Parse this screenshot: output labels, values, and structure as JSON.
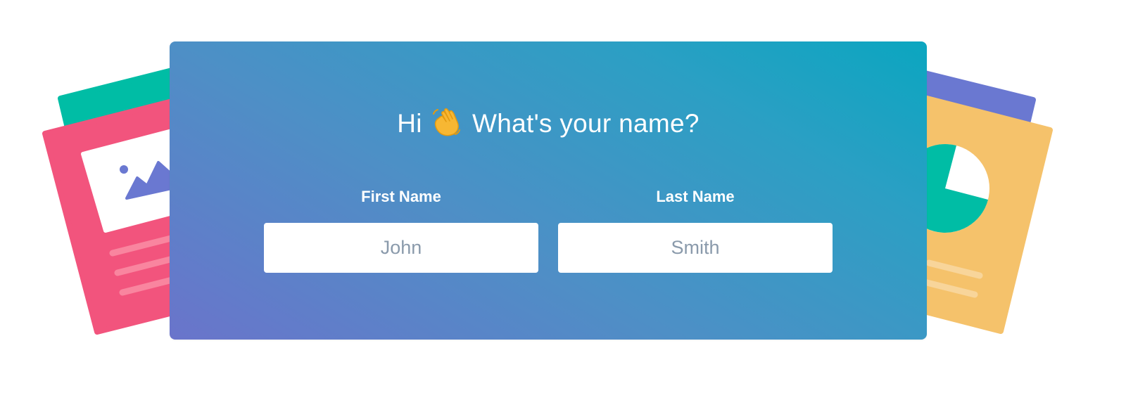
{
  "heading": {
    "prefix": "Hi",
    "icon": "waving-hand-icon",
    "text": "What's your name?"
  },
  "form": {
    "first_name": {
      "label": "First Name",
      "placeholder": "John",
      "value": ""
    },
    "last_name": {
      "label": "Last Name",
      "placeholder": "Smith",
      "value": ""
    }
  },
  "colors": {
    "card_gradient_start": "#6A74CB",
    "card_gradient_end": "#0BA6C0",
    "pink_doc": "#F2547D",
    "teal_doc": "#00BDA5",
    "purple_doc": "#6A78D1",
    "orange_doc": "#F5C26B"
  },
  "decorations": {
    "left": [
      "teal-document-icon",
      "pink-image-document-icon"
    ],
    "right": [
      "purple-document-icon",
      "orange-pie-chart-document-icon"
    ]
  }
}
